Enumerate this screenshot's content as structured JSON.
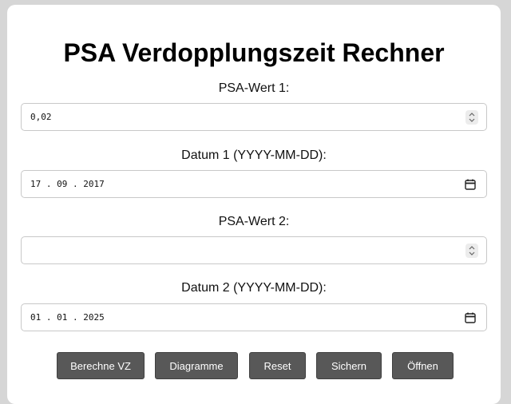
{
  "title": "PSA Verdopplungszeit Rechner",
  "fields": {
    "psa1": {
      "label": "PSA-Wert 1:",
      "value": "0,02"
    },
    "date1": {
      "label": "Datum 1 (YYYY-MM-DD):",
      "value": "17.09.2017",
      "display": "17 . 09 . 2017"
    },
    "psa2": {
      "label": "PSA-Wert 2:",
      "value": ""
    },
    "date2": {
      "label": "Datum 2 (YYYY-MM-DD):",
      "value": "01.01.2025",
      "display": "01 . 01 . 2025"
    }
  },
  "buttons": {
    "calculate": "Berechne VZ",
    "charts": "Diagramme",
    "reset": "Reset",
    "save": "Sichern",
    "open": "Öffnen"
  },
  "icons": {
    "number_spinner": "spinner-icon",
    "date_picker": "calendar-icon"
  },
  "colors": {
    "button_bg": "#585858",
    "page_bg": "#d6d6d6"
  }
}
